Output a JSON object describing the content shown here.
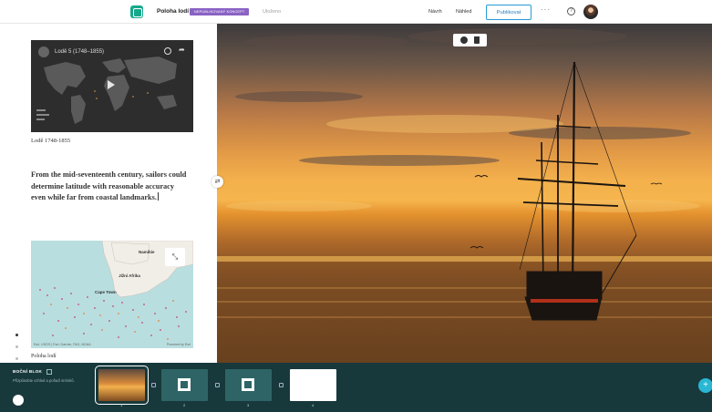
{
  "header": {
    "story_title": "Poloha lodí",
    "draft_badge": "NEPUBLIKOVANÝ KONCEPT",
    "saved_status": "Uloženo",
    "design_label": "Návrh",
    "preview_label": "Náhled",
    "publish_label": "Publikovat",
    "more_icon": "more-horizontal-icon",
    "help_icon": "help-icon"
  },
  "narrative": {
    "video_title": "Lodě 5 (1748–1855)",
    "video_caption": "Lodě 1748-1855",
    "text": "From the mid-seventeenth century, sailors could determine latitude with reasonable accuracy even while far from coastal landmarks.",
    "map": {
      "label_country": "Namibie",
      "label_region": "Jižní Afrika",
      "label_city": "Cape Town",
      "attribution": "Esri, USGS | Esri, Garmin, FAO, NOAA",
      "powered_by": "Powered by Esri"
    },
    "map_caption": "Poloha lodí"
  },
  "media": {
    "description_icons": [
      "gear-icon",
      "trash-icon"
    ]
  },
  "builder": {
    "title": "BOČNÍ BLOK",
    "subtitle": "Přizpůsobte vzhled a pořadí snímků.",
    "slides": [
      {
        "num": "1",
        "type": "photo"
      },
      {
        "num": "2",
        "type": "tile"
      },
      {
        "num": "3",
        "type": "tile"
      },
      {
        "num": "4",
        "type": "blank"
      }
    ],
    "add_label": "+"
  },
  "colors": {
    "accent": "#2a9bd6",
    "brand": "#17a88b",
    "builder_bg": "#17393c",
    "badge": "#8a63c5"
  }
}
